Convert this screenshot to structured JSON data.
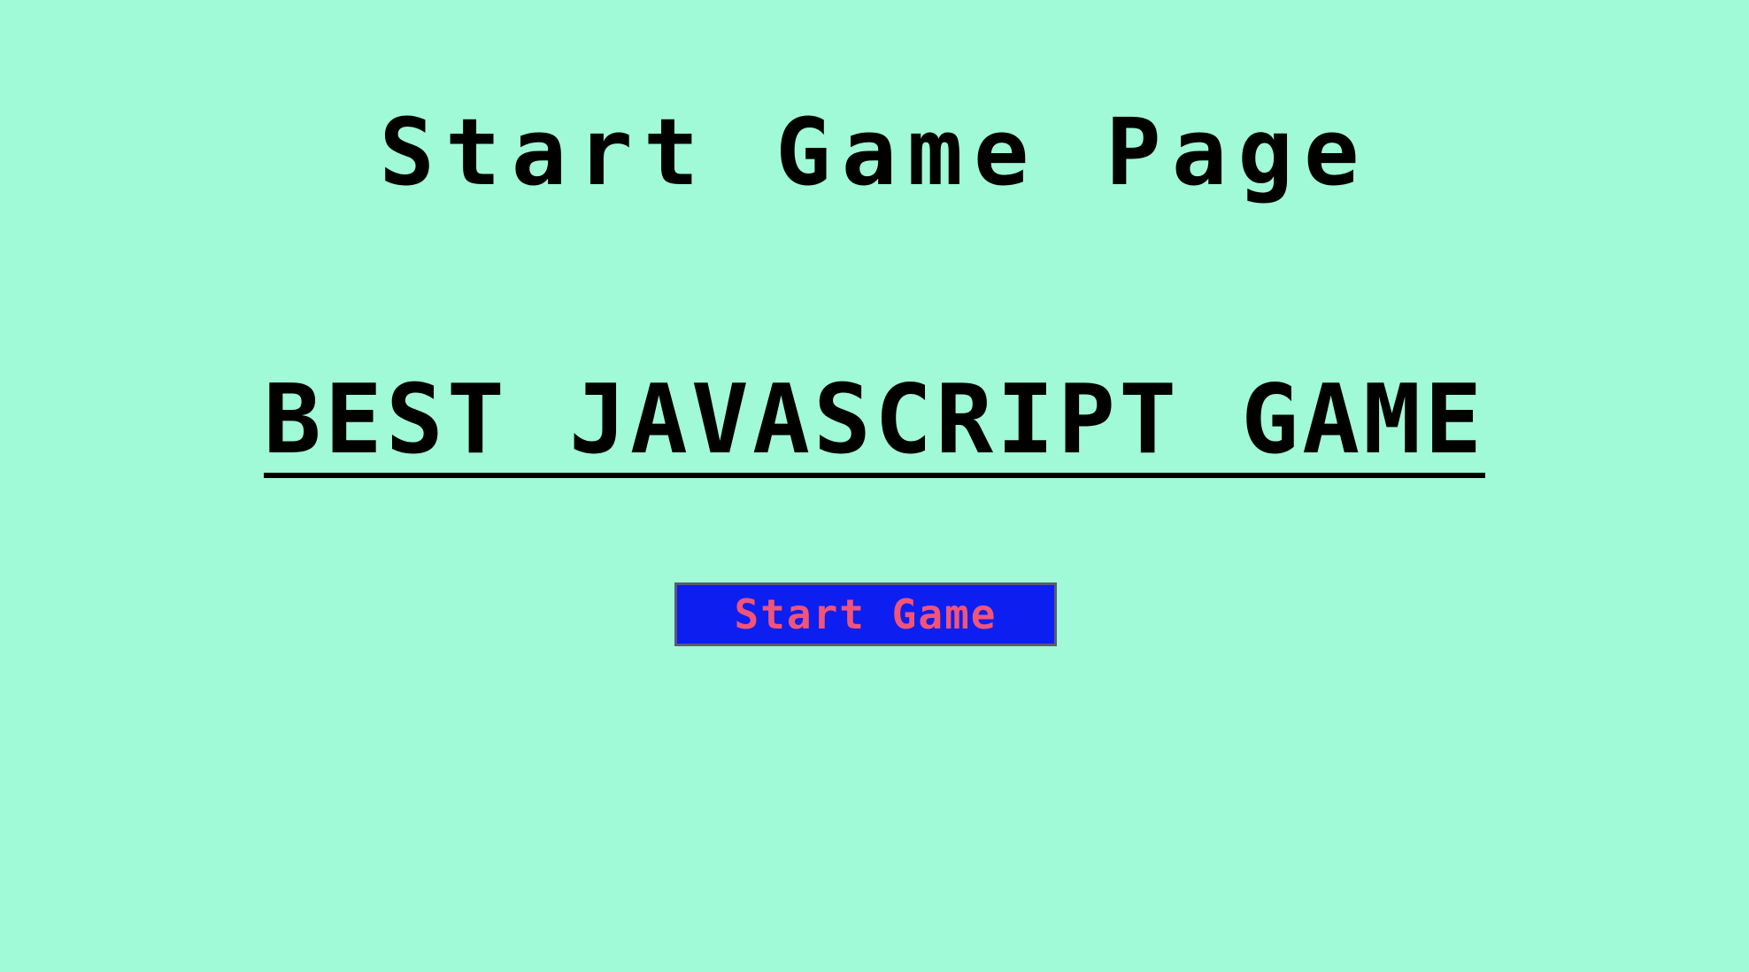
{
  "page": {
    "title": "Start Game Page",
    "headline": "BEST JAVASCRIPT GAME",
    "start_button_label": "Start Game"
  },
  "colors": {
    "background": "#a0f9d7",
    "text": "#000000",
    "button_background": "#0c1ff0",
    "button_text": "#f25477"
  }
}
